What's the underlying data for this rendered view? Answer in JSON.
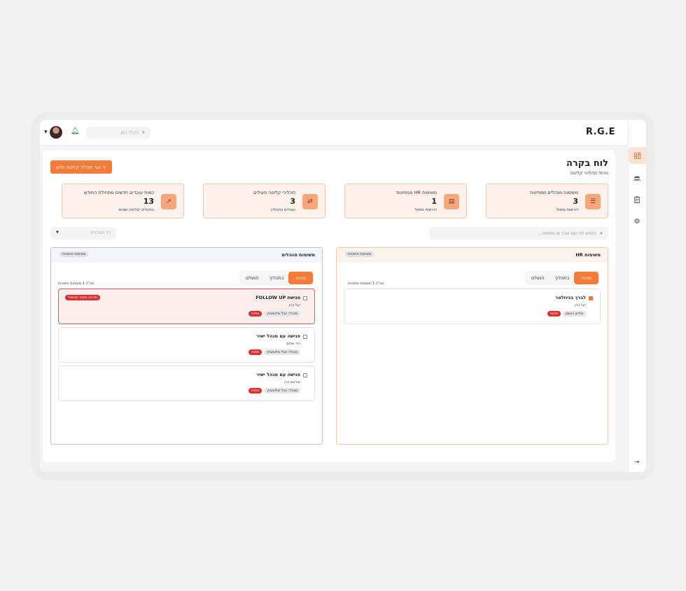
{
  "app": {
    "brand": "R.G.E"
  },
  "topbar": {
    "search_placeholder": "הקלד כאן",
    "avatar_alt": "user avatar"
  },
  "page": {
    "title": "לוח בקרה",
    "subtitle": "ניהול תהליכי קליטה",
    "create_button": "צור תהליך קליטה חדש",
    "create_icon": "+"
  },
  "stats": [
    {
      "label": "משימות מנהלים ממתינות",
      "value": "3",
      "sub": "דורשות טיפול",
      "icon": "list-icon"
    },
    {
      "label": "משימות HR ממתינות",
      "value": "1",
      "sub": "דורשות טיפול",
      "icon": "clipboard-icon"
    },
    {
      "label": "תהליכי קליטה פעילים",
      "value": "3",
      "sub": "עובדים בתהליך",
      "icon": "transfer-icon"
    },
    {
      "label": "כמות עובדים חדשים מתחילת החודש",
      "value": "13",
      "sub": "בתהליכי קליטה שונים",
      "icon": "trending-up-icon"
    }
  ],
  "main_search_placeholder": "חיפוש לפי שם עובד או משימה...",
  "filter": {
    "placeholder": "כל השלבים"
  },
  "hr_column": {
    "title": "משימות HR",
    "badge": "משימות פתוחות",
    "tabs": [
      "פתוח",
      "בתהליך",
      "הושלם"
    ],
    "active_tab": 0,
    "count_line": "סה\"כ 1 משימות פתוחות",
    "tasks": [
      {
        "title": "לברך בגיוזלטר",
        "person": "יעל כהן",
        "tags": [
          "חודש ראשון",
          "פתוח"
        ],
        "warning": ""
      }
    ]
  },
  "mgr_column": {
    "title": "משימות מנהלים",
    "badge": "משימות פתוחות",
    "tabs": [
      "פתוח",
      "בתהליך",
      "הושלם"
    ],
    "active_tab": 0,
    "count_line": "סה\"כ 1 משימות פתוחות",
    "tasks": [
      {
        "title": "פגישת FOLLOW UP",
        "person": "יעל כהן",
        "tags": [
          "מנהל: יובל שלומוביץ",
          "פתוח"
        ],
        "warning": "חריגה בזמני הטיפול"
      },
      {
        "title": "פגישה עם מנהל ישיר",
        "person": "דוד שלום",
        "tags": [
          "מנהל: יובל שלומוביץ",
          "פתוח"
        ],
        "warning": ""
      },
      {
        "title": "פגישה עם מנהל ישיר",
        "person": "אורנים כהן",
        "tags": [
          "מנהל: יובל שלומוביץ",
          "פתוח"
        ],
        "warning": ""
      }
    ]
  },
  "colors": {
    "accent": "#f47b3a",
    "danger": "#d93030",
    "hr_border": "#f5c8ac",
    "mgr_border": "#b8bff0"
  },
  "rail_icons": [
    "dashboard-icon",
    "users-icon",
    "tasks-icon",
    "settings-icon",
    "logout-icon"
  ]
}
